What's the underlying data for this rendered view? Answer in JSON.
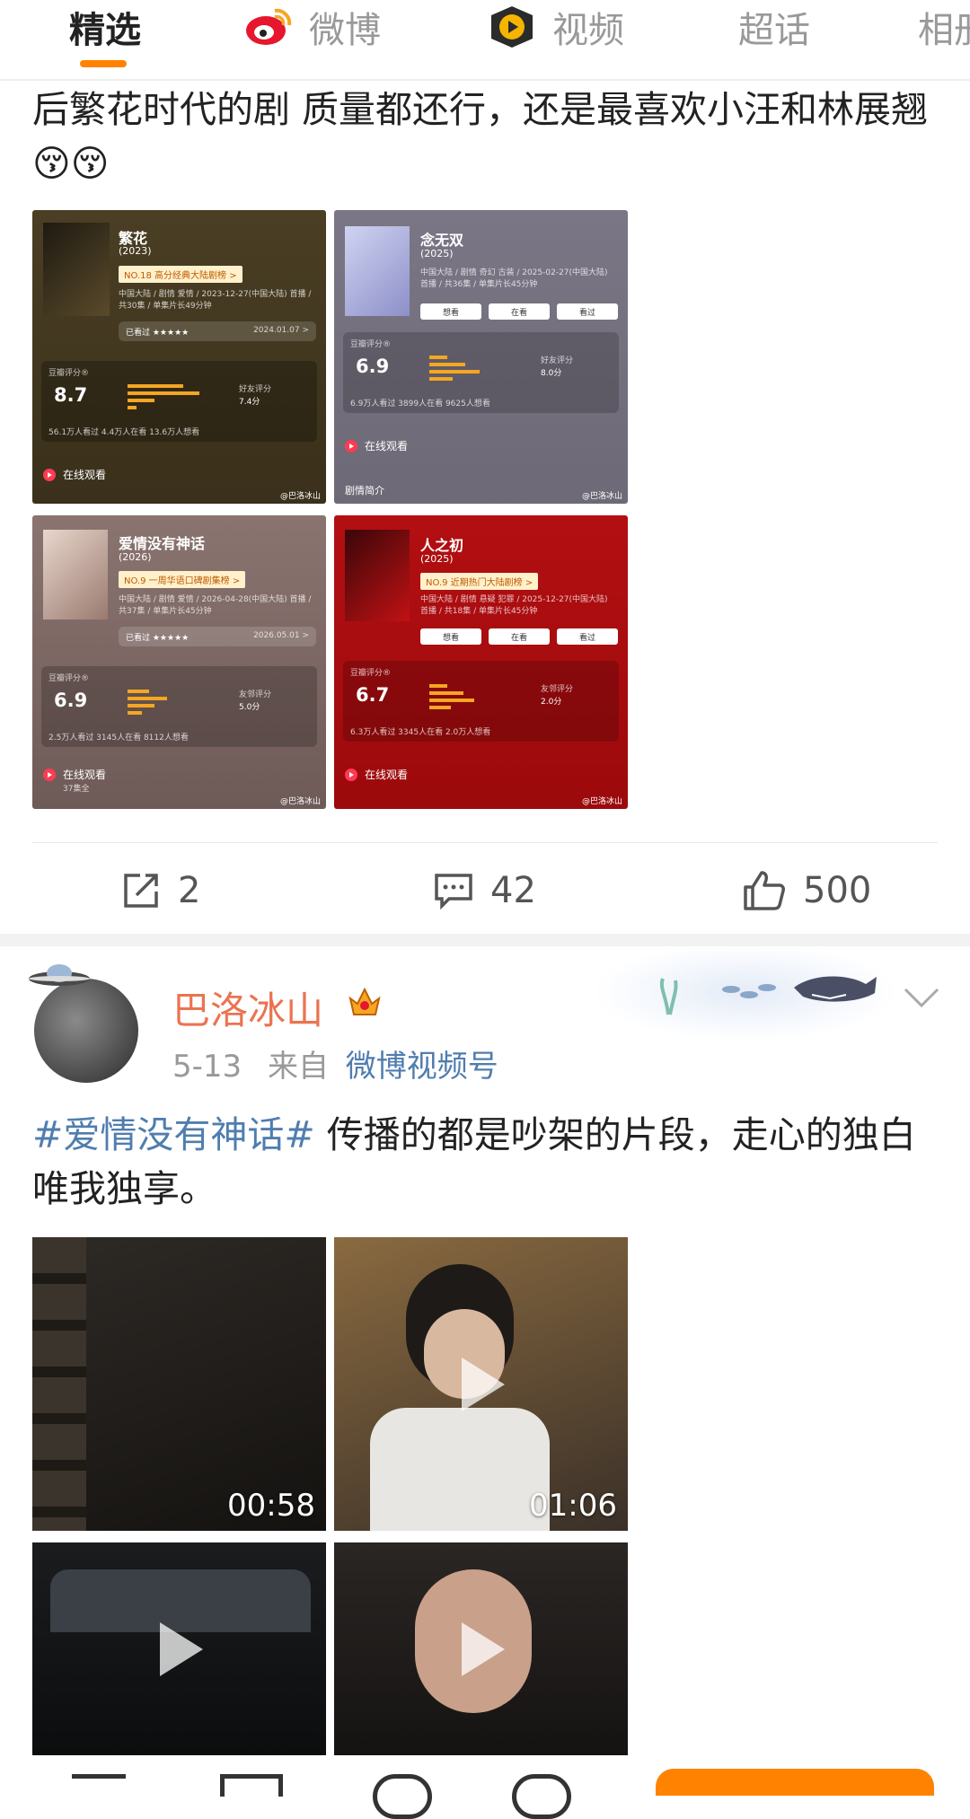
{
  "tabs": [
    {
      "label": "精选",
      "icon": "none"
    },
    {
      "label": "微博",
      "icon": "weibo-logo-icon"
    },
    {
      "label": "视频",
      "icon": "video-play-icon"
    },
    {
      "label": "超话",
      "icon": "none"
    },
    {
      "label": "相册",
      "icon": "none"
    }
  ],
  "post1": {
    "text": "后繁花时代的剧 质量都还行，还是最喜欢小汪和林展翘😚😚",
    "cards": [
      {
        "title": "繁花",
        "year": "(2023)",
        "badge": "NO.18  高分经典大陆剧榜 >",
        "meta": "中国大陆 / 剧情 爱情 / 2023-12-27(中国大陆) 首播 / 共30集 / 单集片长49分钟",
        "seen": "已看过 ★★★★★",
        "seen_date": "2024.01.07 >",
        "rating_label": "豆瓣评分®",
        "score": "8.7",
        "friend_label": "好友评分",
        "friend_score": "7.4分",
        "stats": "56.1万人看过   4.4万人在看   13.6万人想看",
        "watch": "在线观看",
        "watermark": "@巴洛冰山"
      },
      {
        "title": "念无双",
        "year": "(2025)",
        "meta": "中国大陆 / 剧情 奇幻 古装 / 2025-02-27(中国大陆) 首播 / 共36集 / 单集片长45分钟",
        "buttons": [
          "想看",
          "在看",
          "看过"
        ],
        "rating_label": "豆瓣评分®",
        "score": "6.9",
        "friend_label": "好友评分",
        "friend_score": "8.0分",
        "stats": "6.9万人看过   3899人在看   9625人想看",
        "watch": "在线观看",
        "intro": "剧情简介",
        "watermark": "@巴洛冰山"
      },
      {
        "title": "爱情没有神话",
        "year": "(2026)",
        "badge": "NO.9  一周华语口碑剧集榜 >",
        "meta": "中国大陆 / 剧情 爱情 / 2026-04-28(中国大陆) 首播 / 共37集 / 单集片长45分钟",
        "seen": "已看过 ★★★★★",
        "seen_date": "2026.05.01 >",
        "rating_label": "豆瓣评分®",
        "score": "6.9",
        "friend_label": "友邻评分",
        "friend_score": "5.0分",
        "stats": "2.5万人看过   3145人在看   8112人想看",
        "watch": "在线观看",
        "watch_sub": "37集全",
        "watermark": "@巴洛冰山"
      },
      {
        "title": "人之初",
        "year": "(2025)",
        "badge": "NO.9  近期热门大陆剧榜 >",
        "meta": "中国大陆 / 剧情 悬疑 犯罪 / 2025-12-27(中国大陆) 首播 / 共18集 / 单集片长45分钟",
        "buttons": [
          "想看",
          "在看",
          "看过"
        ],
        "rating_label": "豆瓣评分®",
        "score": "6.7",
        "friend_label": "友邻评分",
        "friend_score": "2.0分",
        "stats": "6.3万人看过   3345人在看   2.0万人想看",
        "watch": "在线观看",
        "watermark": "@巴洛冰山"
      }
    ],
    "actions": {
      "repost": "2",
      "comment": "42",
      "like": "500"
    }
  },
  "post2": {
    "username": "巴洛冰山",
    "date": "5-13",
    "from_label": "来自",
    "source": "微博视频号",
    "hashtag": "#爱情没有神话#",
    "text": " 传播的都是吵架的片段，走心的独白唯我独享。",
    "videos": [
      {
        "duration": "00:58",
        "scene": "dark-room"
      },
      {
        "duration": "01:06",
        "scene": "smiling-woman"
      },
      {
        "duration": "",
        "scene": "car-interior"
      },
      {
        "duration": "",
        "scene": "woman-looking-down"
      }
    ]
  },
  "colors": {
    "accent": "#ff8200",
    "username": "#eb7350",
    "link": "#507daf",
    "text": "#222222"
  }
}
